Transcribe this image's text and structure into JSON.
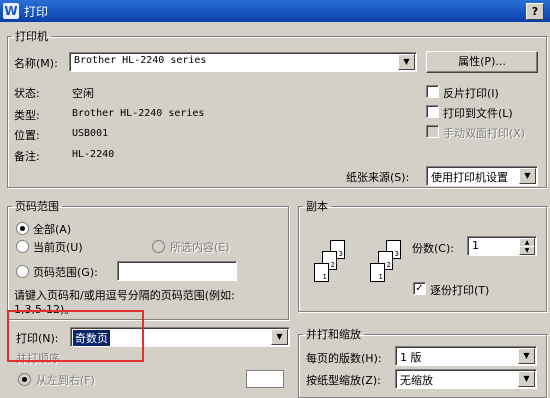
{
  "window": {
    "title": "打印",
    "app_icon": "W",
    "help": "?"
  },
  "printer": {
    "group": "打印机",
    "name_label": "名称(M):",
    "name_value": "Brother HL-2240 series",
    "properties_button": "属性(P)...",
    "status_label": "状态:",
    "status_value": "空闲",
    "type_label": "类型:",
    "type_value": "Brother HL-2240 series",
    "location_label": "位置:",
    "location_value": "USB001",
    "comment_label": "备注:",
    "comment_value": "HL-2240",
    "reverse_print": "反片打印(I)",
    "print_to_file": "打印到文件(L)",
    "manual_duplex": "手动双面打印(X)",
    "paper_source_label": "纸张来源(S):",
    "paper_source_value": "使用打印机设置"
  },
  "page_range": {
    "group": "页码范围",
    "all": "全部(A)",
    "current": "当前页(U)",
    "selection": "所选内容(E)",
    "range": "页码范围(G):",
    "hint": "请键入页码和/或用逗号分隔的页码范围(例如:",
    "example": "1,3,5-12)。"
  },
  "copies": {
    "group": "副本",
    "count_label": "份数(C):",
    "count_value": "1",
    "collate": "逐份打印(T)"
  },
  "print_section": {
    "label": "打印(N):",
    "value": "奇数页",
    "order_label": "并打顺序",
    "order_left_to_right": "从左到右(F)"
  },
  "zoom": {
    "group": "并打和缩放",
    "pages_per_sheet_label": "每页的版数(H):",
    "pages_per_sheet_value": "1 版",
    "scale_label": "按纸型缩放(Z):",
    "scale_value": "无缩放"
  }
}
